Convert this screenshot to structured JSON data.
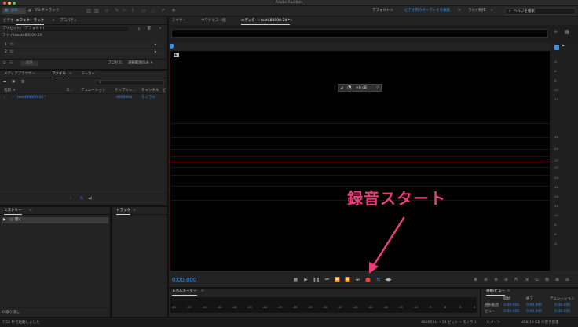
{
  "window": {
    "title": "Adobe Audition"
  },
  "toolbar": {
    "waveform": "波形",
    "multitrack": "マルチトラック",
    "workspace_default": "デフォルト",
    "workspace_video_audio": "ビデオ用のオーディオを編集",
    "workspace_radio": "ラジオ制作",
    "search_placeholder": "ヘルプを検索"
  },
  "left_panel": {
    "tabs": [
      "ビデオ",
      "エフェクトラック",
      "プロパティ"
    ],
    "preset_label": "プリセット:",
    "preset_value": "(デフォルト)",
    "file_label": "ファイル:",
    "file_value": "test480000-24",
    "slots": [
      "1",
      "2"
    ],
    "process_label": "プロセス:",
    "process_value": "選択範囲のみ",
    "apply_label": "適用"
  },
  "media_panel": {
    "tabs": [
      "メディアブラウザー",
      "ファイル",
      "マーカー"
    ],
    "columns": [
      "名前",
      "ス...",
      "デュレーション",
      "サンプルレ...",
      "チャンネル",
      "ビ"
    ],
    "rows": [
      {
        "name": "test480000-24 *",
        "duration": "",
        "samplerate": "48000Hz",
        "channel": "モノラル"
      }
    ]
  },
  "history_panel": {
    "title": "ヒストリー",
    "items": [
      "開く"
    ],
    "undo_count": "0 取り消し"
  },
  "track_panel": {
    "title": "トラック"
  },
  "editor": {
    "tabs": [
      "ミキサー",
      "ウワドネス一個",
      "エディター: test480000-24 *"
    ],
    "hud_value": "+0 dB",
    "time_display": "0:00.000",
    "db_scale": [
      "-3",
      "-6",
      "-9",
      "-12",
      "-15",
      "-21",
      "-24",
      "-27",
      "-27",
      "-24",
      "-21",
      "-18",
      "-15",
      "-12",
      "-9",
      "-6",
      "-3"
    ]
  },
  "level_meter": {
    "title": "レベルメーター",
    "ticks": [
      "dB",
      "-57",
      "-54",
      "-51",
      "-48",
      "-45",
      "-42",
      "-39",
      "-36",
      "-33",
      "-30",
      "-27",
      "-24",
      "-21",
      "-18",
      "-15",
      "-12",
      "-9",
      "-6",
      "-3",
      "0"
    ]
  },
  "selection_view": {
    "title": "選択/ビュー",
    "headers": [
      "開始",
      "終了",
      "デュレーション"
    ],
    "rows": [
      {
        "label": "選択範囲",
        "start": "0:00.000",
        "end": "0:00.000",
        "duration": "0:00.000"
      },
      {
        "label": "ビュー",
        "start": "0:00.000",
        "end": "0:00.000",
        "duration": "0:00.000"
      }
    ]
  },
  "status_bar": {
    "left": "7.58 秒で起動しました",
    "format": "48000 Hz • 24 ビット • モノラル",
    "size": "0 バイト",
    "free": "458.19 GB の空き容量"
  },
  "annotation": {
    "text": "録音スタート"
  },
  "colors": {
    "accent": "#3b8fe4",
    "annotation": "#ea3d7a",
    "record": "#e0453f"
  }
}
